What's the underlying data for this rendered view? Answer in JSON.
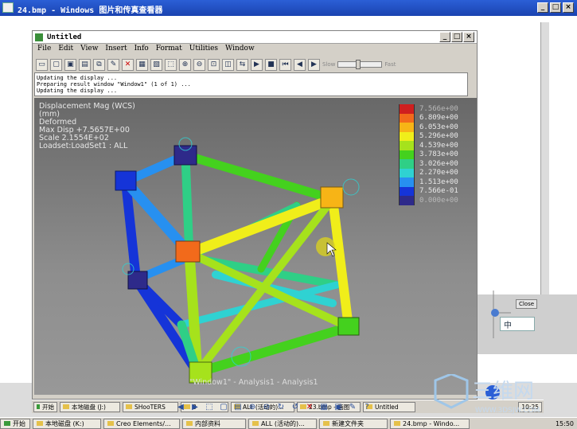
{
  "outer_window": {
    "title": "24.bmp - Windows 图片和传真查看器",
    "controls": [
      "_",
      "□",
      "×"
    ]
  },
  "creo_window": {
    "title": "Untitled",
    "controls": [
      "_",
      "□",
      "×"
    ]
  },
  "menu": [
    "File",
    "Edit",
    "View",
    "Insert",
    "Info",
    "Format",
    "Utilities",
    "Window"
  ],
  "toolbar": {
    "slow_label": "Slow",
    "fast_label": "Fast"
  },
  "messages": "Updating the display ...\nPreparing result window \"Window1\" (1 of 1) ...\nUpdating the display ...",
  "result_info": [
    "Displacement Mag (WCS)",
    "(mm)",
    "Deformed",
    "Max Disp  +7.5657E+00",
    "Scale  2.1554E+02",
    "Loadset:LoadSet1 :  ALL"
  ],
  "legend": [
    {
      "value": "7.566e+00",
      "color": "#cf1f1f"
    },
    {
      "value": "6.809e+00",
      "color": "#f26a1b"
    },
    {
      "value": "6.053e+00",
      "color": "#f7b416"
    },
    {
      "value": "5.296e+00",
      "color": "#f0ee1a"
    },
    {
      "value": "4.539e+00",
      "color": "#a6e21c"
    },
    {
      "value": "3.783e+00",
      "color": "#44d11e"
    },
    {
      "value": "3.026e+00",
      "color": "#2fcf86"
    },
    {
      "value": "2.270e+00",
      "color": "#2fd2d2"
    },
    {
      "value": "1.513e+00",
      "color": "#2790f0"
    },
    {
      "value": "7.566e-01",
      "color": "#1534d8"
    },
    {
      "value": "0.000e+00",
      "color": "#2e2a8a"
    }
  ],
  "window_label": "\"Window1\" - Analysis1 - Analysis1",
  "right_panel": {
    "close_label": "Close",
    "ime_label": "中"
  },
  "inner_taskbar": [
    {
      "label": "开始",
      "icon": "start-icon"
    },
    {
      "label": "本地磁盘 (J:)",
      "icon": "disk-icon"
    },
    {
      "label": "SHooTERS",
      "icon": "folder-icon"
    },
    {
      "label": "3",
      "icon": "folder-icon"
    },
    {
      "label": "ALL (活动的)...",
      "icon": "app-icon"
    },
    {
      "label": "23.bmp - 画图",
      "icon": "paint-icon"
    },
    {
      "label": "Untitled",
      "icon": "app-icon"
    }
  ],
  "inner_clock": "10:25",
  "viewer_buttons": [
    "prev-icon",
    "next-icon",
    "fit-icon",
    "actual-size-icon",
    "slideshow-icon",
    "zoom-in-icon",
    "zoom-out-icon",
    "rotate-cw-icon",
    "rotate-ccw-icon",
    "delete-icon",
    "print-icon",
    "save-icon",
    "edit-icon",
    "help-icon"
  ],
  "main_taskbar": [
    {
      "label": "开始",
      "icon": "start-icon"
    },
    {
      "label": "本地磁盘 (K:)",
      "icon": "disk-icon"
    },
    {
      "label": "Creo Elements/...",
      "icon": "app-icon"
    },
    {
      "label": "内部资料",
      "icon": "folder-icon"
    },
    {
      "label": "ALL (活动的)...",
      "icon": "app-icon"
    },
    {
      "label": "新建文件夹",
      "icon": "folder-icon"
    },
    {
      "label": "24.bmp - Windo...",
      "icon": "viewer-icon"
    }
  ],
  "main_clock": "15:50",
  "watermark": {
    "text": "三维网",
    "url": "WWW.3DSJW.COM"
  }
}
